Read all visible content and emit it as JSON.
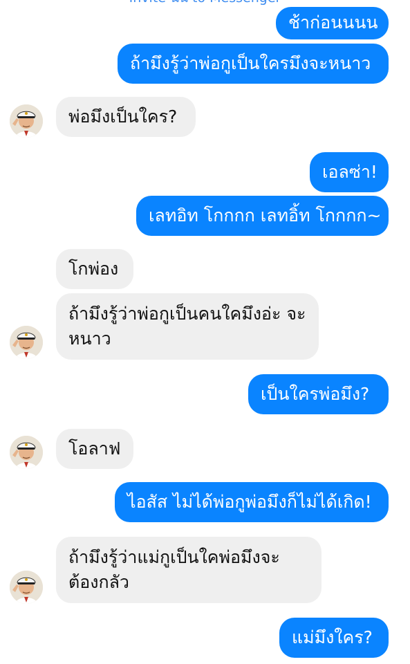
{
  "header": {
    "invite_text": "Invite นัน to Messenger"
  },
  "messages": [
    {
      "sender": "me",
      "text": "ช้าก่อนนนน"
    },
    {
      "sender": "me",
      "text": "ถ้ามึงรู้ว่าพ่อกูเป็นใครมึงจะหนาว"
    },
    {
      "sender": "them",
      "text": "พ่อมึงเป็นใคร?"
    },
    {
      "sender": "me",
      "text": "เอลซ่า!"
    },
    {
      "sender": "me",
      "text": "เลทอิท โกกกก เลทอิ้ท โกกกก~"
    },
    {
      "sender": "them",
      "text": "โกพ่อง"
    },
    {
      "sender": "them",
      "text": "ถ้ามึงรู้ว่าพ่อกูเป็นคนใคมึงอ่ะ จะหนาว"
    },
    {
      "sender": "me",
      "text": "เป็นใครพ่อมึง?"
    },
    {
      "sender": "them",
      "text": "โอลาฟ"
    },
    {
      "sender": "me",
      "text": "ไอสัส ไม่ได้พ่อกูพ่อมึงก็ไม่ได้เกิด!"
    },
    {
      "sender": "them",
      "text": "ถ้ามึงรู้ว่าแม่กูเป็นใคพ่อมึงจะ ต้องกลัว"
    },
    {
      "sender": "me",
      "text": "แม่มึงใคร?"
    }
  ],
  "colors": {
    "outgoing_bubble": "#0a84ff",
    "incoming_bubble": "#efefef",
    "invite_link": "#3d8cf0"
  }
}
